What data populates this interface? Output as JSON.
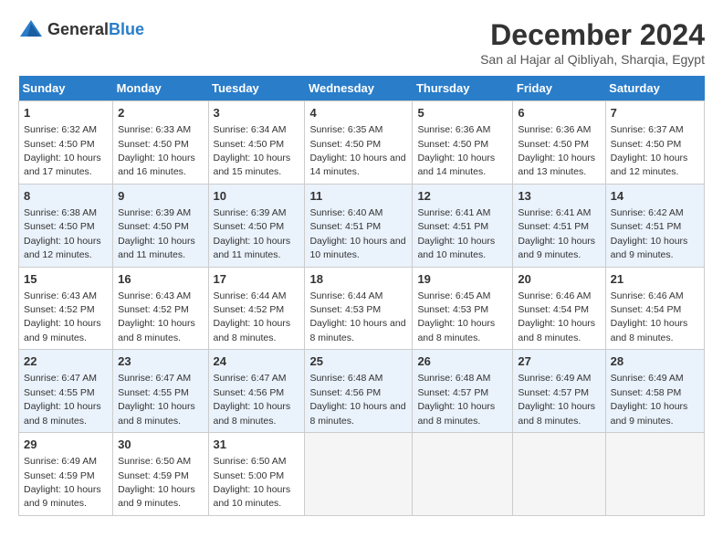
{
  "logo": {
    "general": "General",
    "blue": "Blue"
  },
  "title": "December 2024",
  "subtitle": "San al Hajar al Qibliyah, Sharqia, Egypt",
  "days_header": [
    "Sunday",
    "Monday",
    "Tuesday",
    "Wednesday",
    "Thursday",
    "Friday",
    "Saturday"
  ],
  "weeks": [
    [
      {
        "day": "1",
        "sunrise": "6:32 AM",
        "sunset": "4:50 PM",
        "daylight": "10 hours and 17 minutes."
      },
      {
        "day": "2",
        "sunrise": "6:33 AM",
        "sunset": "4:50 PM",
        "daylight": "10 hours and 16 minutes."
      },
      {
        "day": "3",
        "sunrise": "6:34 AM",
        "sunset": "4:50 PM",
        "daylight": "10 hours and 15 minutes."
      },
      {
        "day": "4",
        "sunrise": "6:35 AM",
        "sunset": "4:50 PM",
        "daylight": "10 hours and 14 minutes."
      },
      {
        "day": "5",
        "sunrise": "6:36 AM",
        "sunset": "4:50 PM",
        "daylight": "10 hours and 14 minutes."
      },
      {
        "day": "6",
        "sunrise": "6:36 AM",
        "sunset": "4:50 PM",
        "daylight": "10 hours and 13 minutes."
      },
      {
        "day": "7",
        "sunrise": "6:37 AM",
        "sunset": "4:50 PM",
        "daylight": "10 hours and 12 minutes."
      }
    ],
    [
      {
        "day": "8",
        "sunrise": "6:38 AM",
        "sunset": "4:50 PM",
        "daylight": "10 hours and 12 minutes."
      },
      {
        "day": "9",
        "sunrise": "6:39 AM",
        "sunset": "4:50 PM",
        "daylight": "10 hours and 11 minutes."
      },
      {
        "day": "10",
        "sunrise": "6:39 AM",
        "sunset": "4:50 PM",
        "daylight": "10 hours and 11 minutes."
      },
      {
        "day": "11",
        "sunrise": "6:40 AM",
        "sunset": "4:51 PM",
        "daylight": "10 hours and 10 minutes."
      },
      {
        "day": "12",
        "sunrise": "6:41 AM",
        "sunset": "4:51 PM",
        "daylight": "10 hours and 10 minutes."
      },
      {
        "day": "13",
        "sunrise": "6:41 AM",
        "sunset": "4:51 PM",
        "daylight": "10 hours and 9 minutes."
      },
      {
        "day": "14",
        "sunrise": "6:42 AM",
        "sunset": "4:51 PM",
        "daylight": "10 hours and 9 minutes."
      }
    ],
    [
      {
        "day": "15",
        "sunrise": "6:43 AM",
        "sunset": "4:52 PM",
        "daylight": "10 hours and 9 minutes."
      },
      {
        "day": "16",
        "sunrise": "6:43 AM",
        "sunset": "4:52 PM",
        "daylight": "10 hours and 8 minutes."
      },
      {
        "day": "17",
        "sunrise": "6:44 AM",
        "sunset": "4:52 PM",
        "daylight": "10 hours and 8 minutes."
      },
      {
        "day": "18",
        "sunrise": "6:44 AM",
        "sunset": "4:53 PM",
        "daylight": "10 hours and 8 minutes."
      },
      {
        "day": "19",
        "sunrise": "6:45 AM",
        "sunset": "4:53 PM",
        "daylight": "10 hours and 8 minutes."
      },
      {
        "day": "20",
        "sunrise": "6:46 AM",
        "sunset": "4:54 PM",
        "daylight": "10 hours and 8 minutes."
      },
      {
        "day": "21",
        "sunrise": "6:46 AM",
        "sunset": "4:54 PM",
        "daylight": "10 hours and 8 minutes."
      }
    ],
    [
      {
        "day": "22",
        "sunrise": "6:47 AM",
        "sunset": "4:55 PM",
        "daylight": "10 hours and 8 minutes."
      },
      {
        "day": "23",
        "sunrise": "6:47 AM",
        "sunset": "4:55 PM",
        "daylight": "10 hours and 8 minutes."
      },
      {
        "day": "24",
        "sunrise": "6:47 AM",
        "sunset": "4:56 PM",
        "daylight": "10 hours and 8 minutes."
      },
      {
        "day": "25",
        "sunrise": "6:48 AM",
        "sunset": "4:56 PM",
        "daylight": "10 hours and 8 minutes."
      },
      {
        "day": "26",
        "sunrise": "6:48 AM",
        "sunset": "4:57 PM",
        "daylight": "10 hours and 8 minutes."
      },
      {
        "day": "27",
        "sunrise": "6:49 AM",
        "sunset": "4:57 PM",
        "daylight": "10 hours and 8 minutes."
      },
      {
        "day": "28",
        "sunrise": "6:49 AM",
        "sunset": "4:58 PM",
        "daylight": "10 hours and 9 minutes."
      }
    ],
    [
      {
        "day": "29",
        "sunrise": "6:49 AM",
        "sunset": "4:59 PM",
        "daylight": "10 hours and 9 minutes."
      },
      {
        "day": "30",
        "sunrise": "6:50 AM",
        "sunset": "4:59 PM",
        "daylight": "10 hours and 9 minutes."
      },
      {
        "day": "31",
        "sunrise": "6:50 AM",
        "sunset": "5:00 PM",
        "daylight": "10 hours and 10 minutes."
      },
      null,
      null,
      null,
      null
    ]
  ]
}
